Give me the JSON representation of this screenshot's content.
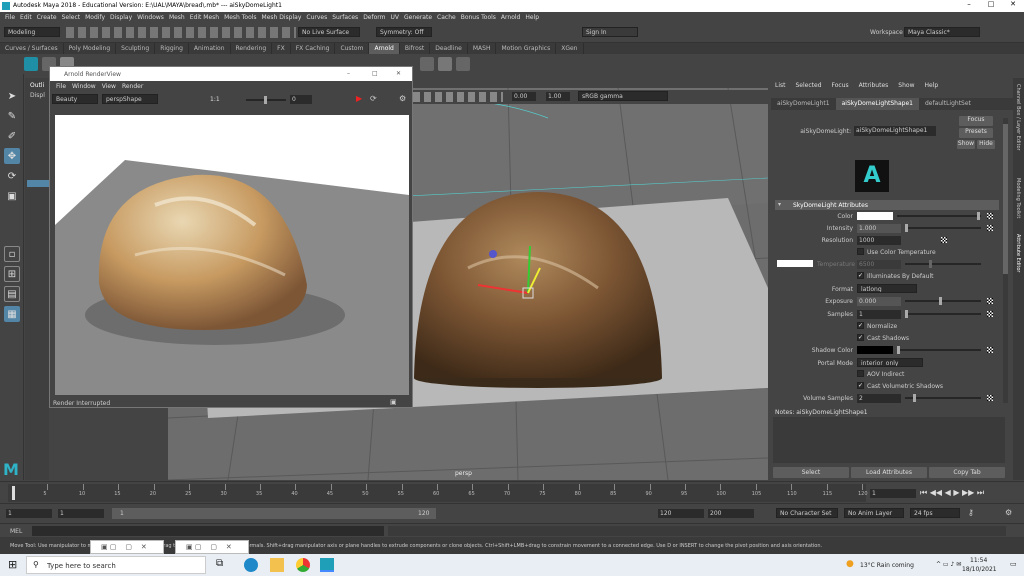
{
  "window": {
    "title": "Autodesk Maya 2018 - Educational Version: E:\\UAL\\MAYA\\bread\\.mb* --- aiSkyDomeLight1"
  },
  "menubar": [
    "File",
    "Edit",
    "Create",
    "Select",
    "Modify",
    "Display",
    "Windows",
    "Mesh",
    "Edit Mesh",
    "Mesh Tools",
    "Mesh Display",
    "Curves",
    "Surfaces",
    "Deform",
    "UV",
    "Generate",
    "Cache",
    "Bonus Tools",
    "Arnold",
    "Help"
  ],
  "workspace": {
    "label": "Workspace :",
    "value": "Maya Classic*"
  },
  "status": {
    "mode": "Modeling",
    "live": "No Live Surface",
    "symmetry": "Symmetry: Off",
    "signin": "Sign In"
  },
  "shelf_tabs": [
    "Curves / Surfaces",
    "Poly Modeling",
    "Sculpting",
    "Rigging",
    "Animation",
    "Rendering",
    "FX",
    "FX Caching",
    "Custom",
    "Arnold",
    "Bifrost",
    "Deadline",
    "MASH",
    "Motion Graphics",
    "XGen"
  ],
  "shelf_active": "Arnold",
  "outliner": {
    "title": "Outli",
    "display": "Displ"
  },
  "renderview": {
    "title": "Arnold RenderView",
    "menu": [
      "File",
      "Window",
      "View",
      "Render"
    ],
    "aov": "Beauty",
    "camera": "perspShape",
    "ratio": "1:1",
    "exposure": "0",
    "status": "Render Interrupted"
  },
  "viewport": {
    "gamma_a": "0.00",
    "gamma_b": "1.00",
    "colorspace": "sRGB gamma",
    "camera_label": "persp"
  },
  "attr_editor": {
    "menu": [
      "List",
      "Selected",
      "Focus",
      "Attributes",
      "Show",
      "Help"
    ],
    "tabs": [
      "aiSkyDomeLight1",
      "aiSkyDomeLightShape1",
      "defaultLightSet"
    ],
    "node_label": "aiSkyDomeLight:",
    "node_value": "aiSkyDomeLightShape1",
    "focus": "Focus",
    "presets": "Presets",
    "show": "Show",
    "hide": "Hide",
    "section": "SkyDomeLight Attributes",
    "color_label": "Color",
    "intensity_label": "Intensity",
    "intensity": "1.000",
    "resolution_label": "Resolution",
    "resolution": "1000",
    "use_color_temp": "Use Color Temperature",
    "temperature_label": "Temperature",
    "temperature": "6500",
    "illuminates": "Illuminates By Default",
    "format_label": "Format",
    "format": "latlong",
    "exposure_label": "Exposure",
    "exposure": "0.000",
    "samples_label": "Samples",
    "samples": "1",
    "normalize": "Normalize",
    "cast_shadows": "Cast Shadows",
    "shadow_color_label": "Shadow Color",
    "portal_label": "Portal Mode",
    "portal": "interior_only",
    "aov_indirect": "AOV Indirect",
    "cast_vol": "Cast Volumetric Shadows",
    "vol_samples_label": "Volume Samples",
    "vol_samples": "2",
    "notes": "Notes: aiSkyDomeLightShape1",
    "btn_select": "Select",
    "btn_load": "Load Attributes",
    "btn_copy": "Copy Tab"
  },
  "side_tabs": [
    "Channel Box / Layer Editor",
    "Modeling Toolkit",
    "Attribute Editor"
  ],
  "timeline": {
    "ticks": [
      "5",
      "10",
      "15",
      "20",
      "25",
      "30",
      "35",
      "40",
      "45",
      "50",
      "55",
      "60",
      "65",
      "70",
      "75",
      "80",
      "85",
      "90",
      "95",
      "100",
      "105",
      "110",
      "115",
      "120"
    ],
    "current": "1"
  },
  "range": {
    "start": "1",
    "inner_start": "1",
    "slider_start": "1",
    "slider_end": "120",
    "end": "120",
    "max": "200",
    "character": "No Character Set",
    "anim_layer": "No Anim Layer",
    "fps": "24 fps"
  },
  "command": {
    "label": "MEL"
  },
  "help_text": "Move Tool: Use manipulator to move object(s). Ctrl+middle-drag to move components along normals. Shift+drag manipulator axis or plane handles to extrude components or clone objects. Ctrl+Shift+LMB+drag to constrain movement to a connected edge. Use D or INSERT to change the pivot position and axis orientation.",
  "taskbar": {
    "search": "Type here to search",
    "weather": "13°C  Rain coming",
    "time": "11:54",
    "date": "18/10/2021"
  }
}
